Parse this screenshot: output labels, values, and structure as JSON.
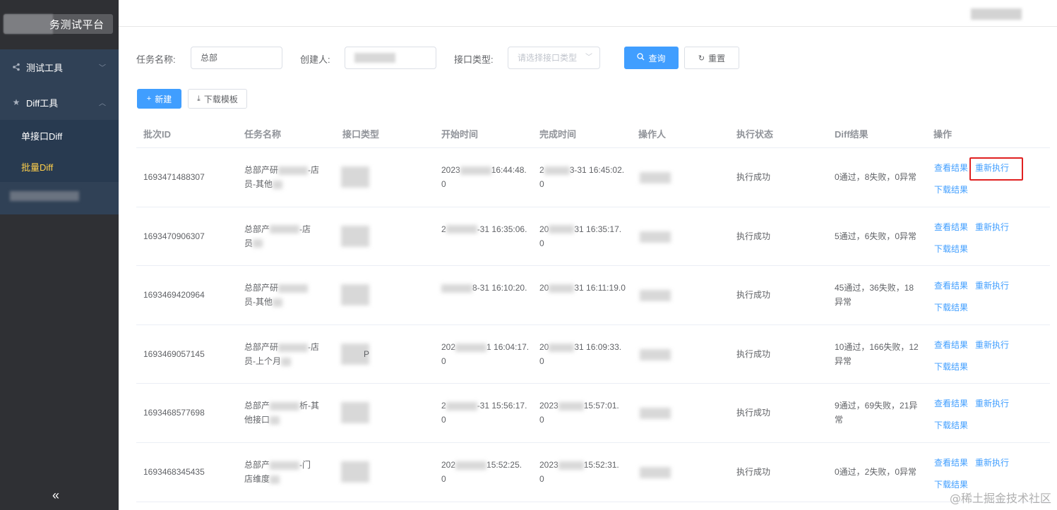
{
  "sidebar": {
    "brand_suffix": "务测试平台",
    "menu": [
      {
        "label": "测试工具",
        "icon": "share-icon",
        "expanded": false
      },
      {
        "label": "Diff工具",
        "icon": "star-icon",
        "expanded": true
      }
    ],
    "submenu": [
      {
        "label": "单接口Diff",
        "active": false
      },
      {
        "label": "批量Diff",
        "active": true
      }
    ],
    "collapse_glyph": "«"
  },
  "filters": {
    "task_name_label": "任务名称:",
    "task_name_value": "总部",
    "creator_label": "创建人:",
    "api_type_label": "接口类型:",
    "api_type_placeholder": "请选择接口类型",
    "search_label": "查询",
    "reset_label": "重置"
  },
  "toolbar": {
    "new_label": "新建",
    "download_template_label": "下载模板"
  },
  "table": {
    "columns": [
      "批次ID",
      "任务名称",
      "接口类型",
      "开始时间",
      "完成时间",
      "操作人",
      "执行状态",
      "Diff结果",
      "操作"
    ],
    "actions": {
      "view": "查看结果",
      "rerun": "重新执行",
      "download": "下载结果"
    },
    "rows": [
      {
        "id": "1693471488307",
        "name1": "总部产研",
        "name1b": "-店",
        "name2": "员-其他",
        "type": "",
        "start1": "2023",
        "start1b": "16:44:48.",
        "start2": "0",
        "end1": "2",
        "end1b": "3-31 16:45:02.",
        "end2": "0",
        "status": "执行成功",
        "result1": "0通过，8失败，0异常",
        "result2": ""
      },
      {
        "id": "1693470906307",
        "name1": "总部产",
        "name1b": "-店",
        "name2": "员",
        "type": "",
        "start1": "2",
        "start1b": "-31 16:35:06.",
        "start2": "",
        "end1": "20",
        "end1b": "31 16:35:17.",
        "end2": "0",
        "status": "执行成功",
        "result1": "5通过，6失败，0异常",
        "result2": ""
      },
      {
        "id": "1693469420964",
        "name1": "总部产研",
        "name1b": "",
        "name2": "员-其他",
        "type": "",
        "start1": "",
        "start1b": "8-31 16:10:20.",
        "start2": "",
        "end1": "20",
        "end1b": "31 16:11:19.0",
        "end2": "",
        "status": "执行成功",
        "result1": "45通过，36失败，18",
        "result2": "异常"
      },
      {
        "id": "1693469057145",
        "name1": "总部产研",
        "name1b": "-店",
        "name2": "员-上个月",
        "type": "P",
        "start1": "202",
        "start1b": "1 16:04:17.",
        "start2": "0",
        "end1": "20",
        "end1b": "31 16:09:33.",
        "end2": "0",
        "status": "执行成功",
        "result1": "10通过，166失败，12",
        "result2": "异常"
      },
      {
        "id": "1693468577698",
        "name1": "总部产",
        "name1b": "析-其",
        "name2": "他接口",
        "type": "",
        "start1": "2",
        "start1b": "-31 15:56:17.",
        "start2": "0",
        "end1": "2023",
        "end1b": "15:57:01.",
        "end2": "0",
        "status": "执行成功",
        "result1": "9通过，69失败，21异",
        "result2": "常"
      },
      {
        "id": "1693468345435",
        "name1": "总部产",
        "name1b": "-门",
        "name2": "店维度",
        "type": "",
        "start1": "202",
        "start1b": "15:52:25.",
        "start2": "0",
        "end1": "2023",
        "end1b": "15:52:31.",
        "end2": "0",
        "status": "执行成功",
        "result1": "0通过，2失败，0异常",
        "result2": ""
      }
    ]
  },
  "watermark": "@稀土掘金技术社区"
}
